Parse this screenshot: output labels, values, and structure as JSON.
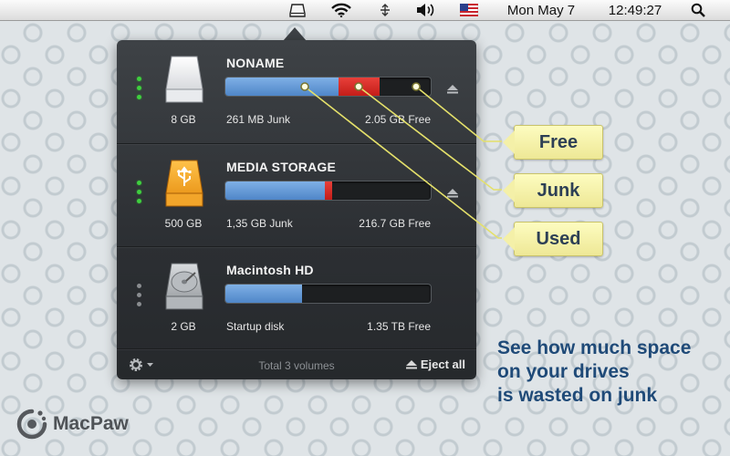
{
  "menubar": {
    "date": "Mon May 7",
    "time": "12:49:27",
    "icons": [
      "drive-menu-icon",
      "wifi-icon",
      "bluetooth-icon",
      "volume-icon",
      "us-flag-icon",
      "spotlight-search-icon"
    ]
  },
  "volumes": [
    {
      "name": "NONAME",
      "size": "8 GB",
      "left_label": "261 MB Junk",
      "free_label": "2.05 GB Free",
      "used_fraction": 0.55,
      "junk_fraction": 0.2,
      "icon": "removable-drive-icon",
      "status": "mounted",
      "ejectable": true
    },
    {
      "name": "MEDIA STORAGE",
      "size": "500 GB",
      "left_label": "1,35 GB Junk",
      "free_label": "216.7 GB Free",
      "used_fraction": 0.485,
      "junk_fraction": 0.035,
      "icon": "usb-drive-icon",
      "status": "mounted",
      "ejectable": true
    },
    {
      "name": "Macintosh HD",
      "size": "2 GB",
      "left_label": "Startup disk",
      "free_label": "1.35 TB Free",
      "used_fraction": 0.375,
      "junk_fraction": 0,
      "icon": "hard-disk-icon",
      "status": "inactive",
      "ejectable": false
    }
  ],
  "footer": {
    "total": "Total 3 volumes",
    "eject_all": "Eject all"
  },
  "callouts": {
    "free": "Free",
    "junk": "Junk",
    "used": "Used"
  },
  "tagline": {
    "line1": "See how much space",
    "line2": "on your drives",
    "line3": "is wasted on junk"
  },
  "brand": {
    "name": "MacPaw"
  },
  "colors": {
    "used": "#5b8fd0",
    "junk": "#d7302a",
    "free": "#1d1f21",
    "callout": "#f5f1a6",
    "tagline": "#1f4a78",
    "indicator_on": "#3fcf3f"
  }
}
